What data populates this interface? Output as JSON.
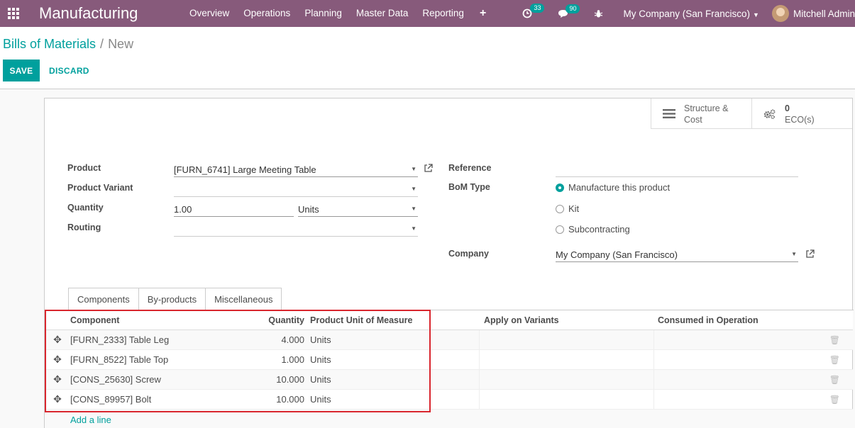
{
  "app": {
    "name": "Manufacturing",
    "menu": [
      "Overview",
      "Operations",
      "Planning",
      "Master Data",
      "Reporting"
    ],
    "plus_label": "+",
    "activity_badge": "33",
    "messages_badge": "90",
    "company": "My Company (San Francisco)",
    "user": "Mitchell Admin"
  },
  "breadcrumb": {
    "parent": "Bills of Materials",
    "separator": "/",
    "current": "New"
  },
  "actions": {
    "save_label": "SAVE",
    "discard_label": "DISCARD"
  },
  "stat_buttons": {
    "structure": {
      "line1": "Structure &",
      "line2": "Cost"
    },
    "eco": {
      "count": "0",
      "label": "ECO(s)"
    }
  },
  "form": {
    "labels": {
      "product": "Product",
      "variant": "Product Variant",
      "quantity": "Quantity",
      "routing": "Routing",
      "reference": "Reference",
      "bom_type": "BoM Type",
      "company": "Company"
    },
    "values": {
      "product": "[FURN_6741] Large Meeting Table",
      "variant": "",
      "quantity": "1.00",
      "uom": "Units",
      "routing": "",
      "reference": "",
      "company": "My Company (San Francisco)"
    },
    "bom_types": [
      {
        "label": "Manufacture this product",
        "checked": true
      },
      {
        "label": "Kit",
        "checked": false
      },
      {
        "label": "Subcontracting",
        "checked": false
      }
    ]
  },
  "tabs": [
    "Components",
    "By-products",
    "Miscellaneous"
  ],
  "table": {
    "headers": {
      "component": "Component",
      "quantity": "Quantity",
      "uom": "Product Unit of Measure",
      "variants": "Apply on Variants",
      "operation": "Consumed in Operation"
    },
    "rows": [
      {
        "component": "[FURN_2333] Table Leg",
        "quantity": "4.000",
        "uom": "Units"
      },
      {
        "component": "[FURN_8522] Table Top",
        "quantity": "1.000",
        "uom": "Units"
      },
      {
        "component": "[CONS_25630] Screw",
        "quantity": "10.000",
        "uom": "Units"
      },
      {
        "component": "[CONS_89957] Bolt",
        "quantity": "10.000",
        "uom": "Units"
      }
    ],
    "add_line": "Add a line"
  },
  "colors": {
    "navbar": "#875a7b",
    "primary": "#00a09d",
    "highlight": "#d9262e"
  }
}
